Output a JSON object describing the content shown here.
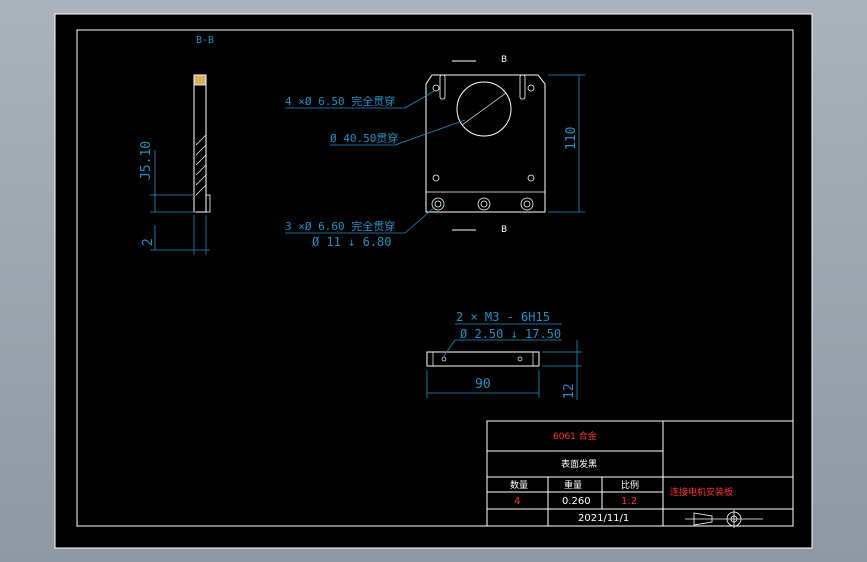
{
  "view_label": "B-B",
  "side_dims": {
    "d1": "J5.10",
    "d2": "2"
  },
  "front_callouts": {
    "top_holes": "4 ×Ø  6.50 完全贯穿",
    "center_bore": "Ø 40.50贯穿",
    "bottom_holes_line1": "3 ×Ø  6.60 完全贯穿",
    "bottom_holes_line2": "Ø 11 ↓ 6.80",
    "height": "110",
    "section_mark": "B"
  },
  "bottom_view": {
    "thread_line1": "2 × M3 - 6H15",
    "thread_line2": "Ø 2.50 ↓ 17.50",
    "width": "90",
    "height": "12"
  },
  "title_block": {
    "material": "6061 合金",
    "finish": "表面发黑",
    "header_qty": "数量",
    "header_weight": "重量",
    "header_scale": "比例",
    "qty": "4",
    "weight": "0.260",
    "scale": "1:2",
    "part_name": "连接电机安装板",
    "date": "2021/11/1"
  }
}
